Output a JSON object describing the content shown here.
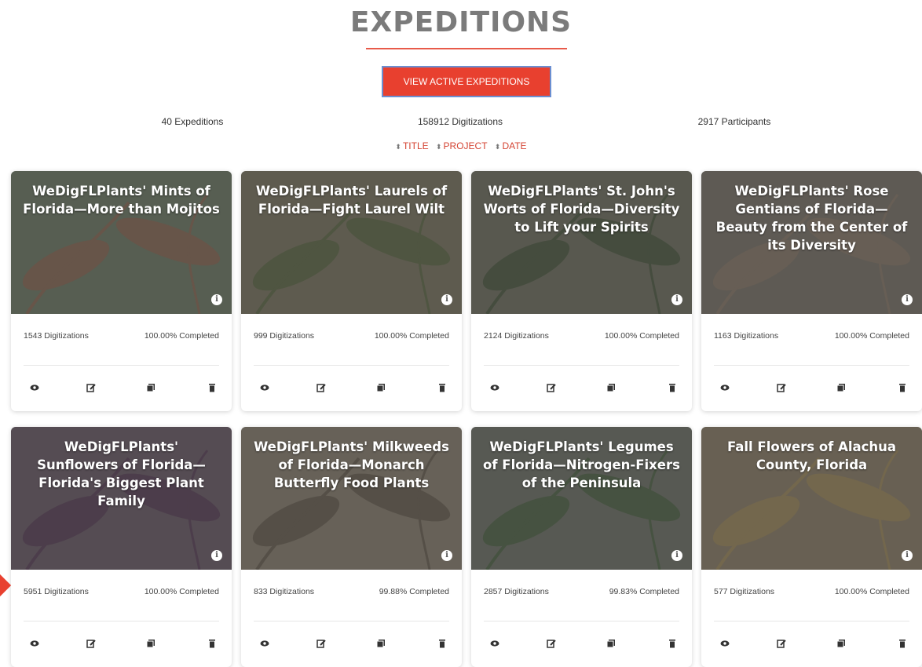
{
  "page": {
    "title": "EXPEDITIONS",
    "cta_label": "VIEW ACTIVE EXPEDITIONS",
    "stats": {
      "expeditions": "40 Expeditions",
      "digitizations": "158912 Digitizations",
      "participants": "2917 Participants"
    },
    "sort": [
      "TITLE",
      "PROJECT",
      "DATE"
    ]
  },
  "colors": {
    "accent": "#e8402f",
    "title": "#7b7b7b"
  },
  "cards": [
    {
      "title": "WeDigFLPlants' Mints of Florida—More than Mojitos",
      "digitizations": "1543 Digitizations",
      "completed": "100.00% Completed"
    },
    {
      "title": "WeDigFLPlants' Laurels of Florida—Fight Laurel Wilt",
      "digitizations": "999 Digitizations",
      "completed": "100.00% Completed"
    },
    {
      "title": "WeDigFLPlants' St. John's Worts of Florida—Diversity to Lift your Spirits",
      "digitizations": "2124 Digitizations",
      "completed": "100.00% Completed"
    },
    {
      "title": "WeDigFLPlants' Rose Gentians of Florida—Beauty from the Center of its Diversity",
      "digitizations": "1163 Digitizations",
      "completed": "100.00% Completed"
    },
    {
      "title": "WeDigFLPlants' Sunflowers of Florida—Florida's Biggest Plant Family",
      "digitizations": "5951 Digitizations",
      "completed": "100.00% Completed"
    },
    {
      "title": "WeDigFLPlants' Milkweeds of Florida—Monarch Butterfly Food Plants",
      "digitizations": "833 Digitizations",
      "completed": "99.88% Completed"
    },
    {
      "title": "WeDigFLPlants' Legumes of Florida—Nitrogen-Fixers of the Peninsula",
      "digitizations": "2857 Digitizations",
      "completed": "99.83% Completed"
    },
    {
      "title": "Fall Flowers of Alachua County, Florida",
      "digitizations": "577 Digitizations",
      "completed": "100.00% Completed"
    }
  ],
  "card_actions": [
    "eye-icon",
    "edit-icon",
    "copy-icon",
    "trash-icon"
  ]
}
